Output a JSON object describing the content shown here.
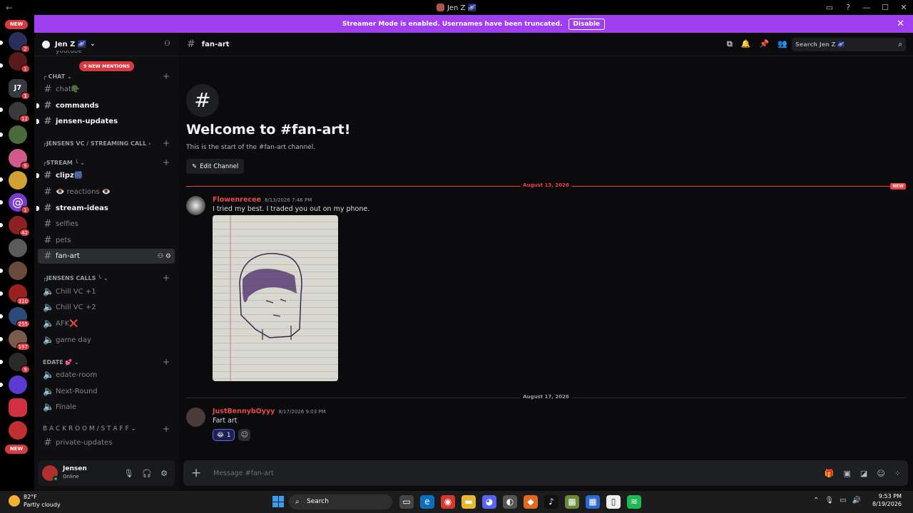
{
  "window": {
    "title": "Jen Z 🌌",
    "back_icon": "←",
    "forward_icon": "→",
    "controls": [
      "▭",
      "?",
      "—",
      "☐",
      "✕"
    ]
  },
  "guilds": {
    "new_top": "NEW",
    "new_bottom": "NEW",
    "items": [
      {
        "badge": "2",
        "color": "#2a2f5a"
      },
      {
        "badge": "1",
        "color": "#5a1a1a"
      },
      {
        "label": "J7",
        "badge": "1",
        "color": "#36393f"
      },
      {
        "badge": "12",
        "color": "#3a3a3a"
      },
      {
        "badge": "",
        "color": "#4a6a3a"
      },
      {
        "badge": "9",
        "color": "#d05a8a"
      },
      {
        "badge": "",
        "color": "#d0a030"
      },
      {
        "label": "@",
        "badge": "1",
        "color": "#7a3ad0"
      },
      {
        "badge": "42",
        "color": "#8a2020"
      },
      {
        "badge": "",
        "color": "#5a5a5a"
      },
      {
        "badge": "",
        "color": "#6a4a3a"
      },
      {
        "badge": "310",
        "color": "#9a2020"
      },
      {
        "badge": "255",
        "color": "#2a4a7a"
      },
      {
        "badge": "197",
        "color": "#7a5a4a"
      },
      {
        "badge": "9",
        "color": "#2a2a2a"
      },
      {
        "badge": "",
        "color": "#5a3ad0"
      },
      {
        "badge": "",
        "color": "#d03040"
      },
      {
        "badge": "",
        "color": "#c03030"
      }
    ]
  },
  "banner": {
    "text": "Streamer Mode is enabled. Usernames have been truncated.",
    "button": "Disable",
    "close": "✕"
  },
  "server": {
    "name": "Jen Z 🌌",
    "chevron": "⌄",
    "mentions_badge": "9 NEW MENTIONS",
    "clipped_channel": "youtube",
    "categories": [
      {
        "label": "╭ CHAT ⌄"
      },
      {
        "label": "╭JENSENS VC / STREAMING CALL ›"
      },
      {
        "label": "╭STREAM ╰ ⌄"
      },
      {
        "label": "╭JENSENS CALLS ╰ ⌄"
      },
      {
        "label": "EDATE 💕 ⌄"
      },
      {
        "label": "B A C K R O O M  /  S T A F F ⌄"
      }
    ],
    "channels": {
      "chat": "chat🪖",
      "commands": "commands",
      "jensen_updates": "jensen-updates",
      "clipz": "clipz🎆",
      "reactions": "👁️ reactions 👁️",
      "stream_ideas": "stream-ideas",
      "selfies": "selfies",
      "pets": "pets",
      "fan_art": "fan-art",
      "chill_vc_1": "Chill VC +1",
      "chill_vc_2": "Chill VC +2",
      "afk": "AFK❌",
      "game_day": "game day",
      "edate_room": "edate-room",
      "next_round": "Next-Round",
      "finale": "Finale",
      "private_updates": "private-updates"
    }
  },
  "user": {
    "name": "Jensen",
    "status": "Online"
  },
  "channel": {
    "name": "fan-art",
    "search_placeholder": "Search Jen Z 🌌",
    "welcome_title": "Welcome to #fan-art!",
    "welcome_sub": "This is the start of the #fan-art channel.",
    "edit_button": "Edit Channel",
    "composer_placeholder": "Message #fan-art"
  },
  "messages": {
    "divider1": "August 13, 2026",
    "new_tag": "NEW",
    "divider2": "August 17, 2026",
    "m1": {
      "author": "Flowenrecee",
      "time": "8/13/2026 7:46 PM",
      "text": "I tried my best. I traded you out on my phone."
    },
    "m2": {
      "author": "JustBennybOyyy",
      "time": "8/17/2026 9:03 PM",
      "text": "Fart art",
      "reaction_emoji": "😂",
      "reaction_count": "1"
    }
  },
  "taskbar": {
    "temp": "82°F",
    "weather": "Partly cloudy",
    "search": "Search",
    "time": "9:53 PM",
    "date": "8/19/2026"
  },
  "colors": {
    "accent": "#a03ff0",
    "author": "#e94b4b",
    "new_line": "#f23f43",
    "badge": "#d83a42"
  }
}
